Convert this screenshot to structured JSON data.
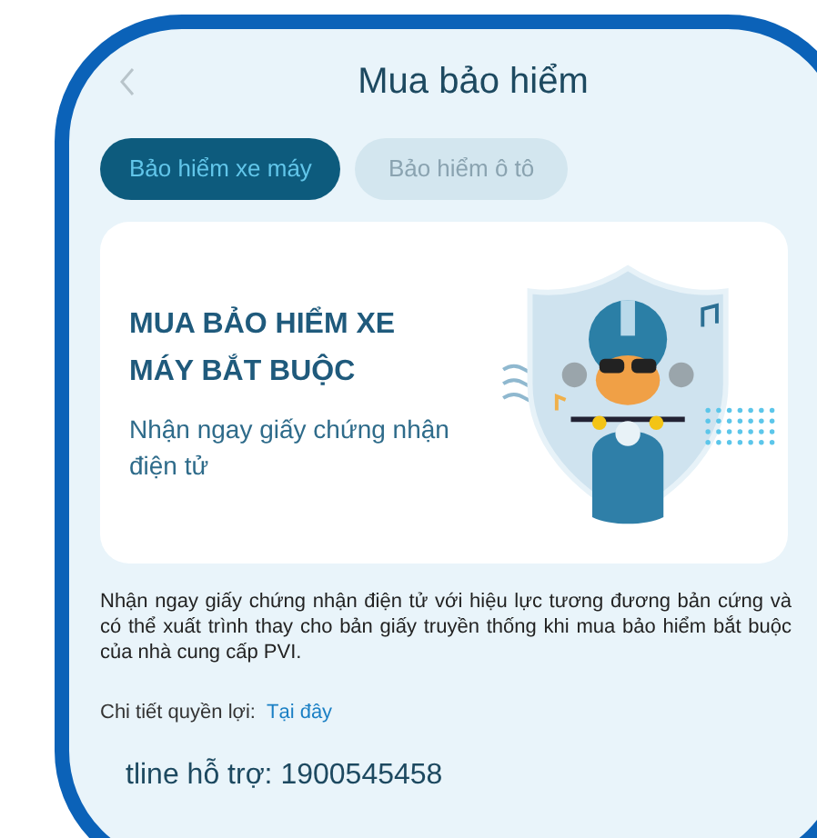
{
  "header": {
    "title": "Mua bảo hiểm"
  },
  "tabs": [
    {
      "label": "Bảo hiểm xe máy",
      "selected": true
    },
    {
      "label": "Bảo hiểm ô tô",
      "selected": false
    }
  ],
  "banner": {
    "heading_lines": [
      "MUA BẢO HIỂM XE",
      "MÁY BẮT BUỘC"
    ],
    "subtitle": "Nhận ngay giấy chứng nhận điện tử"
  },
  "description": "Nhận ngay giấy chứng nhận điện tử với hiệu lực tương đương bản cứng và có thể xuất trình thay cho bản giấy truyền thống khi mua bảo hiểm bắt buộc của nhà cung cấp PVI.",
  "benefits": {
    "label": "Chi tiết quyền lợi:",
    "link": "Tại đây"
  },
  "hotline": "tline hỗ trợ: 1900545458"
}
